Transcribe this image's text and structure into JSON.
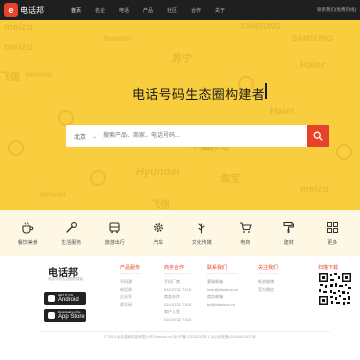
{
  "header": {
    "logo_mark": "e",
    "logo_text": "电话邦",
    "nav": [
      "首页",
      "名企",
      "电话",
      "产品",
      "社区",
      "合作",
      "关于"
    ],
    "right_text": "联系我们(免费热线)"
  },
  "hero": {
    "slogan": "电话号码生态圈构建者",
    "watermarks": [
      "meizu",
      "SAMSUNG",
      "SAMSUNG",
      "meizu",
      "huawei",
      "lenovo",
      "飞信",
      "Haier",
      "淘宝",
      "Hyundai",
      "meizu",
      "苏宁",
      "lenovo",
      "Haier",
      "飞信",
      "中国移动"
    ],
    "search": {
      "city": "北京",
      "placeholder": "搜索产品、商家、电话号码..."
    }
  },
  "categories": [
    {
      "label": "餐饮美食",
      "icon": "coffee-cup-icon"
    },
    {
      "label": "生活服务",
      "icon": "tools-icon"
    },
    {
      "label": "旅游出行",
      "icon": "car-icon"
    },
    {
      "label": "汽车",
      "icon": "gear-icon"
    },
    {
      "label": "文化传媒",
      "icon": "leaf-icon"
    },
    {
      "label": "电商",
      "icon": "cart-icon"
    },
    {
      "label": "建材",
      "icon": "paint-roller-icon"
    },
    {
      "label": "更多",
      "icon": "more-icon"
    }
  ],
  "footer": {
    "brand": "电话邦",
    "sub": "电话号码生态圈构建者",
    "store_android": {
      "small": "GET IT ON",
      "big": "Android"
    },
    "store_ios": {
      "small": "Download on the",
      "big": "App Store"
    },
    "col1": {
      "title": "产品服务",
      "lines": [
        "号码通",
        "电话邦",
        "企业号",
        "邦号码"
      ]
    },
    "col2": {
      "title": "商务合作",
      "lines": [
        "手机厂商",
        "010-5732 7318",
        "商务合作",
        "010-5732 7318",
        "商户入驻",
        "010-5732 7318"
      ]
    },
    "col3": {
      "title": "联系我们",
      "lines": [
        "客服邮箱",
        "help@dianhua.cn",
        "商务邮箱",
        "bd@dianhua.cn"
      ]
    },
    "col4": {
      "title": "关注我们",
      "lines": [
        "新浪微博",
        "官方微信"
      ]
    },
    "qr_title": "扫描下载",
    "copyright": "© 2015 北京羲和科技有限公司 Dianhua.cn 京ICP备 12034232号-1 京公网安备110105011521号"
  },
  "colors": {
    "accent": "#e8432a",
    "hero_bg": "#f8cd3e",
    "topbar": "#1f1f1f"
  }
}
